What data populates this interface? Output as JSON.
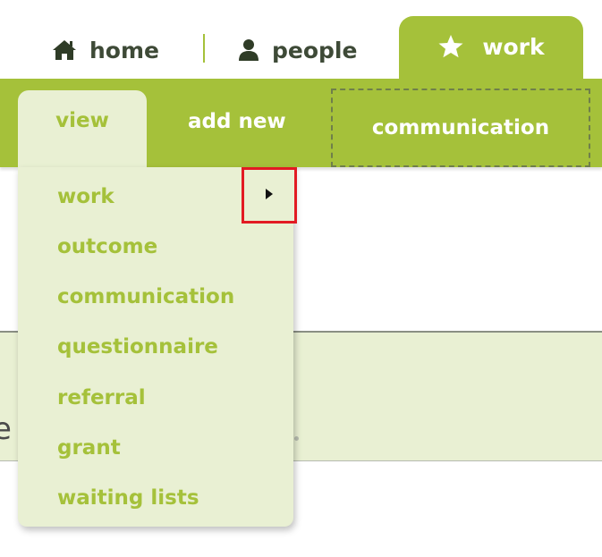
{
  "top_nav": {
    "home": {
      "label": "home",
      "icon": "home-icon"
    },
    "people": {
      "label": "people",
      "icon": "person-icon"
    },
    "work": {
      "label": "work",
      "icon": "star-icon",
      "active": true
    }
  },
  "sub_nav": {
    "view": {
      "label": "view",
      "active": true
    },
    "add_new": {
      "label": "add new"
    },
    "communication": {
      "label": "communication"
    }
  },
  "dropdown": {
    "items": [
      {
        "label": "work",
        "has_submenu": true
      },
      {
        "label": "outcome"
      },
      {
        "label": "communication"
      },
      {
        "label": "questionnaire"
      },
      {
        "label": "referral"
      },
      {
        "label": "grant"
      },
      {
        "label": "waiting lists"
      }
    ],
    "submenu_icon": "caret-right-icon"
  },
  "background": {
    "partial_text": "e"
  },
  "colors": {
    "accent": "#a5c13a",
    "light": "#e9f0d3",
    "dark_text": "#3e4a37",
    "highlight": "#e21b23"
  }
}
